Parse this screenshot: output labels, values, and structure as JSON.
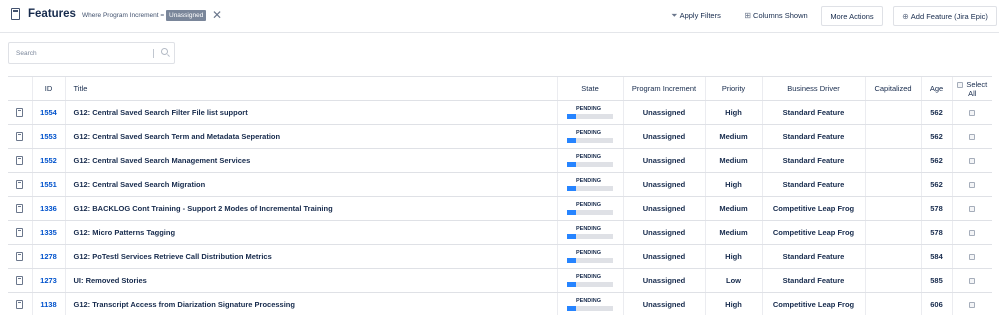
{
  "header": {
    "title": "Features",
    "filter_text": "Where Program Increment =",
    "filter_chip": "Unassigned",
    "clear_icon": "close-icon",
    "apply_filters": "Apply Filters",
    "apply_icon": "funnel-icon",
    "columns_shown": "Columns Shown",
    "columns_icon": "grid-icon",
    "more_actions": "More Actions",
    "add_feature": "Add Feature (Jira Epic)",
    "add_icon": "plus-circle-icon"
  },
  "search": {
    "placeholder": "Search",
    "icon": "search-icon"
  },
  "table": {
    "columns": {
      "id": "ID",
      "title": "Title",
      "state": "State",
      "program_increment": "Program Increment",
      "priority": "Priority",
      "business_driver": "Business Driver",
      "capitalized": "Capitalized",
      "age": "Age",
      "select_all": "Select All"
    },
    "rows": [
      {
        "id": "1554",
        "title": "G12: Central Saved Search Filter File list support",
        "state": "PENDING",
        "state_progress": 0.2,
        "program_increment": "Unassigned",
        "priority": "High",
        "business_driver": "Standard Feature",
        "capitalized": "",
        "age": "562"
      },
      {
        "id": "1553",
        "title": "G12: Central Saved Search Term and Metadata Seperation",
        "state": "PENDING",
        "state_progress": 0.2,
        "program_increment": "Unassigned",
        "priority": "Medium",
        "business_driver": "Standard Feature",
        "capitalized": "",
        "age": "562"
      },
      {
        "id": "1552",
        "title": "G12: Central Saved Search Management Services",
        "state": "PENDING",
        "state_progress": 0.2,
        "program_increment": "Unassigned",
        "priority": "Medium",
        "business_driver": "Standard Feature",
        "capitalized": "",
        "age": "562"
      },
      {
        "id": "1551",
        "title": "G12: Central Saved Search Migration",
        "state": "PENDING",
        "state_progress": 0.2,
        "program_increment": "Unassigned",
        "priority": "High",
        "business_driver": "Standard Feature",
        "capitalized": "",
        "age": "562"
      },
      {
        "id": "1336",
        "title": "G12: BACKLOG Cont Training - Support 2 Modes of Incremental Training",
        "state": "PENDING",
        "state_progress": 0.2,
        "program_increment": "Unassigned",
        "priority": "Medium",
        "business_driver": "Competitive Leap Frog",
        "capitalized": "",
        "age": "578"
      },
      {
        "id": "1335",
        "title": "G12: Micro Patterns Tagging",
        "state": "PENDING",
        "state_progress": 0.2,
        "program_increment": "Unassigned",
        "priority": "Medium",
        "business_driver": "Competitive Leap Frog",
        "capitalized": "",
        "age": "578"
      },
      {
        "id": "1278",
        "title": "G12: PoTestl Services Retrieve Call Distribution Metrics",
        "state": "PENDING",
        "state_progress": 0.2,
        "program_increment": "Unassigned",
        "priority": "High",
        "business_driver": "Standard Feature",
        "capitalized": "",
        "age": "584"
      },
      {
        "id": "1273",
        "title": "UI: Removed Stories",
        "state": "PENDING",
        "state_progress": 0.2,
        "program_increment": "Unassigned",
        "priority": "Low",
        "business_driver": "Standard Feature",
        "capitalized": "",
        "age": "585"
      },
      {
        "id": "1138",
        "title": "G12: Transcript Access from Diarization Signature Processing",
        "state": "PENDING",
        "state_progress": 0.2,
        "program_increment": "Unassigned",
        "priority": "High",
        "business_driver": "Competitive Leap Frog",
        "capitalized": "",
        "age": "606"
      }
    ]
  },
  "colors": {
    "accent": "#0052cc",
    "progress": "#2684ff",
    "chip": "#7a869a"
  }
}
